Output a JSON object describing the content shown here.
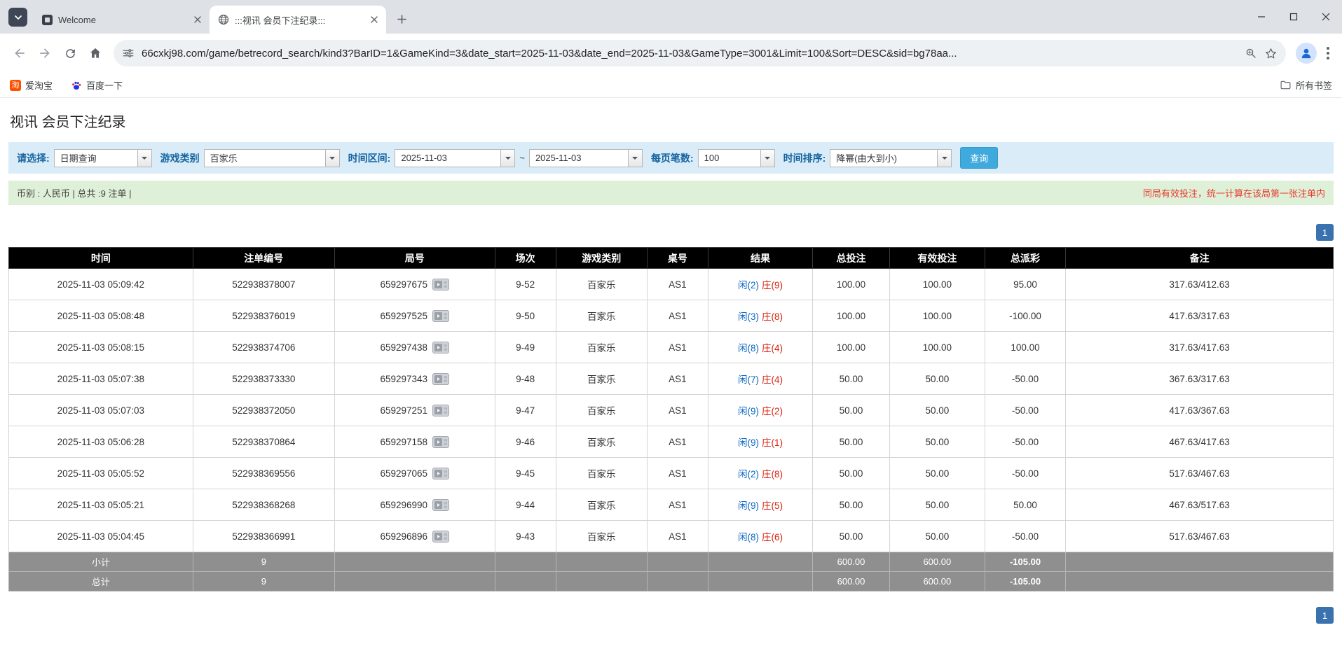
{
  "browser": {
    "tabs": [
      {
        "title": "Welcome"
      },
      {
        "title": ":::视讯 会员下注纪录:::"
      }
    ],
    "url": "66cxkj98.com/game/betrecord_search/kind3?BarID=1&GameKind=3&date_start=2025-11-03&date_end=2025-11-03&GameType=3001&Limit=100&Sort=DESC&sid=bg78aa...",
    "bookmarks": [
      {
        "label": "爱淘宝",
        "icon_char": "淘"
      },
      {
        "label": "百度一下"
      }
    ],
    "all_bookmarks_label": "所有书签"
  },
  "icons": {
    "tab_search": "chevron-down",
    "back": "arrow-left",
    "forward": "arrow-right",
    "reload": "circular-arrow",
    "home": "house",
    "site_info": "tune-sliders",
    "zoom": "magnifier",
    "bookmark_star": "star-outline",
    "profile": "person-circle",
    "menu": "vertical-dots",
    "all_bookmarks": "folder",
    "round_replay": "video-clip",
    "combo_arrow": "triangle-down"
  },
  "colors": {
    "filter_bg": "#d9ecf7",
    "info_bg": "#dff0d8",
    "header_bg": "#000000",
    "footer_bg": "#8f8f8f",
    "accent_blue": "#41aadd",
    "pager_blue": "#3a72b0",
    "link_blue": "#0a66c2",
    "loss_red": "#d90000",
    "banker_red": "#d9230f"
  },
  "page": {
    "title": "视讯 会员下注纪录",
    "filter": {
      "select_label": "请选择:",
      "select_value": "日期查询",
      "game_type_label": "游戏类别",
      "game_type_value": "百家乐",
      "date_range_label": "时间区间:",
      "date_start": "2025-11-03",
      "date_separator": "~",
      "date_end": "2025-11-03",
      "per_page_label": "每页笔数:",
      "per_page_value": "100",
      "sort_label": "时间排序:",
      "sort_value": "降幂(由大到小)",
      "search_button": "查询"
    },
    "info_bar": {
      "left": "币别 : 人民币 | 总共 :9 注单 |",
      "right": "同局有效投注，统一计算在该局第一张注单内"
    },
    "pagination": "1"
  },
  "table": {
    "headers": [
      "时间",
      "注单编号",
      "局号",
      "场次",
      "游戏类别",
      "桌号",
      "结果",
      "总投注",
      "有效投注",
      "总派彩",
      "备注"
    ],
    "col_widths": [
      "13.9%",
      "10.7%",
      "12.1%",
      "4.6%",
      "6.9%",
      "4.6%",
      "7.9%",
      "5.8%",
      "7.2%",
      "6.1%",
      "20.2%"
    ],
    "rows": [
      {
        "time": "2025-11-03 05:09:42",
        "bet_id": "522938378007",
        "round": "659297675",
        "session": "9-52",
        "game": "百家乐",
        "table": "AS1",
        "player": "闲(2)",
        "banker": "庄(9)",
        "total_bet": "100.00",
        "valid_bet": "100.00",
        "payout": "95.00",
        "note": "317.63/412.63"
      },
      {
        "time": "2025-11-03 05:08:48",
        "bet_id": "522938376019",
        "round": "659297525",
        "session": "9-50",
        "game": "百家乐",
        "table": "AS1",
        "player": "闲(3)",
        "banker": "庄(8)",
        "total_bet": "100.00",
        "valid_bet": "100.00",
        "payout": "-100.00",
        "note": "417.63/317.63"
      },
      {
        "time": "2025-11-03 05:08:15",
        "bet_id": "522938374706",
        "round": "659297438",
        "session": "9-49",
        "game": "百家乐",
        "table": "AS1",
        "player": "闲(8)",
        "banker": "庄(4)",
        "total_bet": "100.00",
        "valid_bet": "100.00",
        "payout": "100.00",
        "note": "317.63/417.63"
      },
      {
        "time": "2025-11-03 05:07:38",
        "bet_id": "522938373330",
        "round": "659297343",
        "session": "9-48",
        "game": "百家乐",
        "table": "AS1",
        "player": "闲(7)",
        "banker": "庄(4)",
        "total_bet": "50.00",
        "valid_bet": "50.00",
        "payout": "-50.00",
        "note": "367.63/317.63"
      },
      {
        "time": "2025-11-03 05:07:03",
        "bet_id": "522938372050",
        "round": "659297251",
        "session": "9-47",
        "game": "百家乐",
        "table": "AS1",
        "player": "闲(9)",
        "banker": "庄(2)",
        "total_bet": "50.00",
        "valid_bet": "50.00",
        "payout": "-50.00",
        "note": "417.63/367.63"
      },
      {
        "time": "2025-11-03 05:06:28",
        "bet_id": "522938370864",
        "round": "659297158",
        "session": "9-46",
        "game": "百家乐",
        "table": "AS1",
        "player": "闲(9)",
        "banker": "庄(1)",
        "total_bet": "50.00",
        "valid_bet": "50.00",
        "payout": "-50.00",
        "note": "467.63/417.63"
      },
      {
        "time": "2025-11-03 05:05:52",
        "bet_id": "522938369556",
        "round": "659297065",
        "session": "9-45",
        "game": "百家乐",
        "table": "AS1",
        "player": "闲(2)",
        "banker": "庄(8)",
        "total_bet": "50.00",
        "valid_bet": "50.00",
        "payout": "-50.00",
        "note": "517.63/467.63"
      },
      {
        "time": "2025-11-03 05:05:21",
        "bet_id": "522938368268",
        "round": "659296990",
        "session": "9-44",
        "game": "百家乐",
        "table": "AS1",
        "player": "闲(9)",
        "banker": "庄(5)",
        "total_bet": "50.00",
        "valid_bet": "50.00",
        "payout": "50.00",
        "note": "467.63/517.63"
      },
      {
        "time": "2025-11-03 05:04:45",
        "bet_id": "522938366991",
        "round": "659296896",
        "session": "9-43",
        "game": "百家乐",
        "table": "AS1",
        "player": "闲(8)",
        "banker": "庄(6)",
        "total_bet": "50.00",
        "valid_bet": "50.00",
        "payout": "-50.00",
        "note": "517.63/467.63"
      }
    ],
    "subtotal": {
      "label": "小计",
      "count": "9",
      "total_bet": "600.00",
      "valid_bet": "600.00",
      "payout": "-105.00"
    },
    "total": {
      "label": "总计",
      "count": "9",
      "total_bet": "600.00",
      "valid_bet": "600.00",
      "payout": "-105.00"
    }
  }
}
